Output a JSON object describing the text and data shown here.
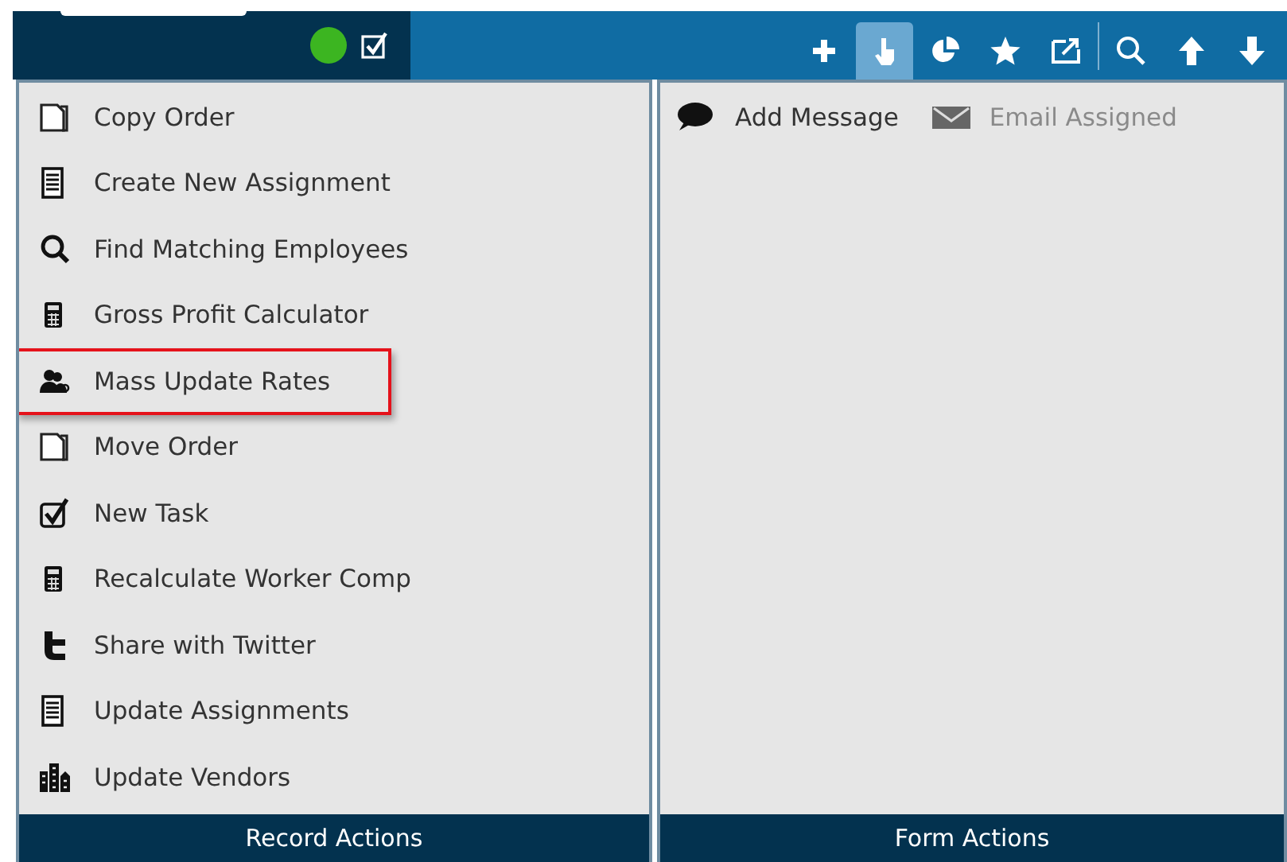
{
  "header": {
    "status_dot": {
      "color": "#3cb521"
    },
    "checkbox": {
      "checked": true
    },
    "toolbar": [
      {
        "selected": false
      },
      {
        "selected": true
      },
      {
        "selected": false
      },
      {
        "selected": false
      },
      {
        "selected": false
      },
      {
        "selected": false
      },
      {
        "selected": false
      },
      {
        "selected": false
      }
    ]
  },
  "record_actions": {
    "items": [
      {
        "label": "Copy Order",
        "highlighted": false
      },
      {
        "label": "Create New Assignment",
        "highlighted": false
      },
      {
        "label": "Find Matching Employees",
        "highlighted": false
      },
      {
        "label": "Gross Profit Calculator",
        "highlighted": false
      },
      {
        "label": "Mass Update Rates",
        "highlighted": true
      },
      {
        "label": "Move Order",
        "highlighted": false
      },
      {
        "label": "New Task",
        "highlighted": false
      },
      {
        "label": "Recalculate Worker Comp",
        "highlighted": false
      },
      {
        "label": "Share with Twitter",
        "highlighted": false
      },
      {
        "label": "Update Assignments",
        "highlighted": false
      },
      {
        "label": "Update Vendors",
        "highlighted": false
      }
    ],
    "footer": "Record Actions"
  },
  "form_actions": {
    "items": [
      {
        "label": "Add Message",
        "disabled": false
      },
      {
        "label": "Email Assigned",
        "disabled": true
      }
    ],
    "footer": "Form Actions"
  }
}
